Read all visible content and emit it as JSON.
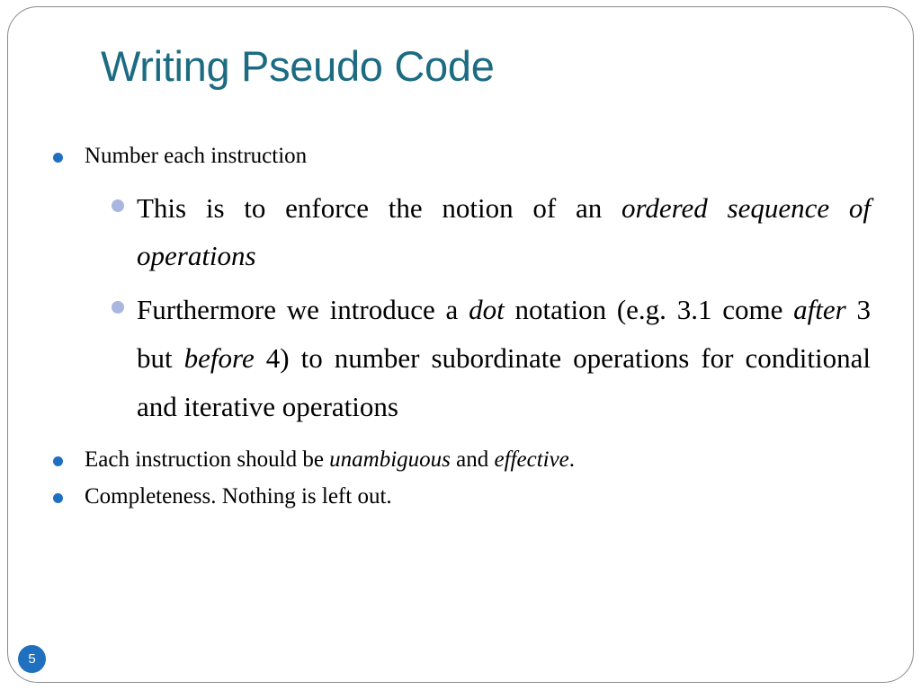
{
  "slide": {
    "title": "Writing Pseudo Code",
    "page_number": "5",
    "accent_color": "#1c6b82",
    "bullet_color": "#1f70bf",
    "sub_bullet_color": "#a9b6e0",
    "background_color": "#ffffff",
    "frame_color": "#8a8a8a",
    "text_color": "#000000"
  },
  "content": {
    "bullet1": {
      "text": "Number each instruction",
      "sub": [
        {
          "segments": [
            {
              "text": "This is to enforce the notion of an ",
              "italic": false
            },
            {
              "text": "ordered sequence of operations",
              "italic": true
            }
          ],
          "plain": "This is to enforce the notion of an ordered sequence of operations"
        },
        {
          "segments": [
            {
              "text": " Furthermore we introduce a ",
              "italic": false
            },
            {
              "text": "dot",
              "italic": true
            },
            {
              "text": " notation (e.g. 3.1 come ",
              "italic": false
            },
            {
              "text": "after",
              "italic": true
            },
            {
              "text": " 3 but ",
              "italic": false
            },
            {
              "text": "before",
              "italic": true
            },
            {
              "text": " 4) to number subordinate operations for conditional and iterative operations",
              "italic": false
            }
          ],
          "plain": " Furthermore we introduce a dot notation (e.g. 3.1 come after 3 but before 4) to number subordinate operations for conditional and iterative operations"
        }
      ]
    },
    "bullet2": {
      "segments": [
        {
          "text": "Each instruction should be ",
          "italic": false
        },
        {
          "text": "unambiguous",
          "italic": true
        },
        {
          "text": " and ",
          "italic": false
        },
        {
          "text": "effective",
          "italic": true
        },
        {
          "text": ".",
          "italic": false
        }
      ],
      "plain": "Each instruction should be unambiguous and effective."
    },
    "bullet3": {
      "text": "Completeness. Nothing is left out."
    }
  },
  "rich": {
    "sub1_pre": "This is to enforce the notion of an ",
    "sub1_ital": "ordered sequence of operations",
    "sub2_a": " Furthermore we introduce a ",
    "sub2_dot": "dot",
    "sub2_b": " notation (e.g. 3.1 come ",
    "sub2_after": "after",
    "sub2_c": " 3 but ",
    "sub2_before": "before",
    "sub2_d": " 4) to number subordinate operations for conditional and iterative operations",
    "b2_a": "Each instruction should be ",
    "b2_unamb": "unambiguous",
    "b2_b": " and ",
    "b2_eff": "effective",
    "b2_c": "."
  }
}
